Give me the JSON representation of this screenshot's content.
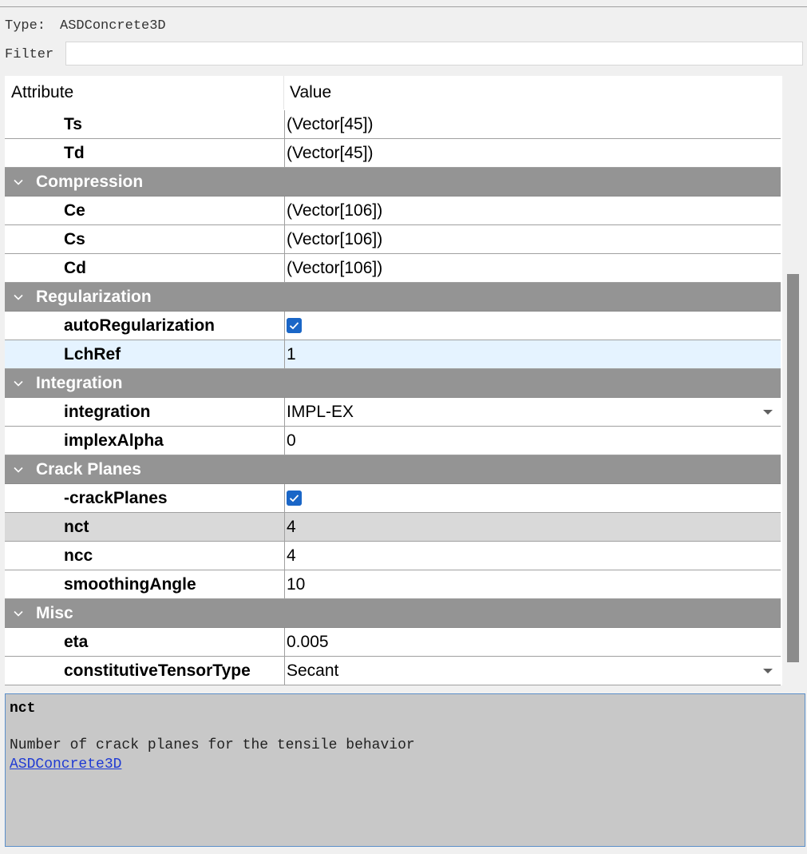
{
  "header": {
    "type_label": "Type:",
    "type_value": "ASDConcrete3D",
    "filter_label": "Filter",
    "filter_value": ""
  },
  "columns": {
    "attribute": "Attribute",
    "value": "Value"
  },
  "rows": [
    {
      "kind": "prop",
      "name": "Ts",
      "value": "(Vector[45])"
    },
    {
      "kind": "prop",
      "name": "Td",
      "value": "(Vector[45])"
    },
    {
      "kind": "group",
      "name": "Compression"
    },
    {
      "kind": "prop",
      "name": "Ce",
      "value": "(Vector[106])"
    },
    {
      "kind": "prop",
      "name": "Cs",
      "value": "(Vector[106])"
    },
    {
      "kind": "prop",
      "name": "Cd",
      "value": "(Vector[106])"
    },
    {
      "kind": "group",
      "name": "Regularization"
    },
    {
      "kind": "prop",
      "name": "autoRegularization",
      "value": "",
      "checkbox": true
    },
    {
      "kind": "prop",
      "name": "LchRef",
      "value": "1",
      "state": "hover"
    },
    {
      "kind": "group",
      "name": "Integration"
    },
    {
      "kind": "prop",
      "name": "integration",
      "value": "IMPL-EX",
      "dropdown": true
    },
    {
      "kind": "prop",
      "name": "implexAlpha",
      "value": "0"
    },
    {
      "kind": "group",
      "name": "Crack Planes"
    },
    {
      "kind": "prop",
      "name": "-crackPlanes",
      "value": "",
      "checkbox": true
    },
    {
      "kind": "prop",
      "name": "nct",
      "value": "4",
      "state": "selected"
    },
    {
      "kind": "prop",
      "name": "ncc",
      "value": "4"
    },
    {
      "kind": "prop",
      "name": "smoothingAngle",
      "value": "10"
    },
    {
      "kind": "group",
      "name": "Misc"
    },
    {
      "kind": "prop",
      "name": "eta",
      "value": "0.005"
    },
    {
      "kind": "prop",
      "name": "constitutiveTensorType",
      "value": "Secant",
      "dropdown": true
    }
  ],
  "help": {
    "title": "nct",
    "description": "Number of crack planes for the tensile behavior",
    "link": "ASDConcrete3D"
  },
  "colors": {
    "group_bg": "#949494",
    "checkbox": "#1a66c7",
    "hover_row": "#e5f3ff",
    "selected_row": "#d9d9d9",
    "help_bg": "#c8c8c8",
    "link": "#1f3ad3"
  }
}
